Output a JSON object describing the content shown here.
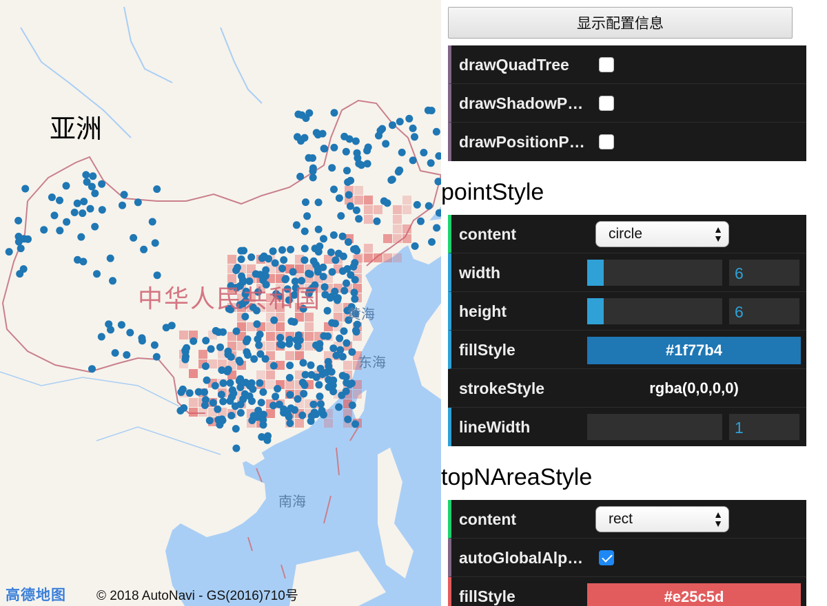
{
  "map": {
    "continent_label": "亚洲",
    "country_label": "中华人民共和国",
    "seas": [
      "黄海",
      "东海",
      "南海"
    ],
    "logo": "高德地图",
    "attribution": "© 2018 AutoNavi - GS(2016)710号",
    "colors": {
      "water": "#a9cef5",
      "land": "#f6f3ec",
      "border": "#c97f8c",
      "point": "#1f77b4",
      "heat": "#e25c5d"
    }
  },
  "panel": {
    "show_config_button": "显示配置信息",
    "debug_rows": [
      {
        "label": "drawQuadTree",
        "checked": false
      },
      {
        "label": "drawShadowPo…",
        "checked": false
      },
      {
        "label": "drawPositionP…",
        "checked": false
      }
    ],
    "point_style": {
      "title": "pointStyle",
      "content": {
        "label": "content",
        "value": "circle"
      },
      "width": {
        "label": "width",
        "value": "6",
        "fill": 0.12
      },
      "height": {
        "label": "height",
        "value": "6",
        "fill": 0.12
      },
      "fill_style": {
        "label": "fillStyle",
        "value": "#1f77b4"
      },
      "stroke_style": {
        "label": "strokeStyle",
        "value": "rgba(0,0,0,0)"
      },
      "line_width": {
        "label": "lineWidth",
        "value": "1",
        "fill": 0.0
      }
    },
    "top_n_area_style": {
      "title": "topNAreaStyle",
      "content": {
        "label": "content",
        "value": "rect"
      },
      "auto_global_alpha": {
        "label": "autoGlobalAlp…",
        "checked": true
      },
      "fill_style": {
        "label": "fillStyle",
        "value": "#e25c5d"
      }
    }
  }
}
